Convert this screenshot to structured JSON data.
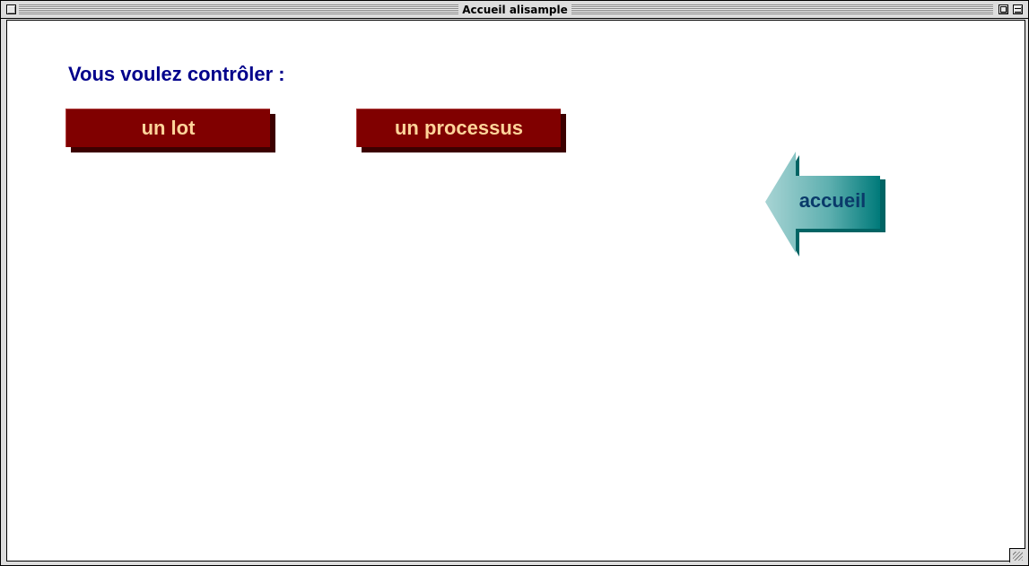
{
  "window": {
    "title": "Accueil alisample"
  },
  "main": {
    "heading": "Vous voulez contrôler :",
    "buttons": {
      "lot_label": "un lot",
      "process_label": "un processus"
    },
    "home_arrow_label": "accueil"
  },
  "colors": {
    "heading": "#00008b",
    "button_face": "#800000",
    "button_text": "#ffd49a",
    "arrow_teal": "#007f7f",
    "arrow_text": "#0a3a6a"
  },
  "icons": {
    "home_arrow": "left-arrow-icon"
  }
}
